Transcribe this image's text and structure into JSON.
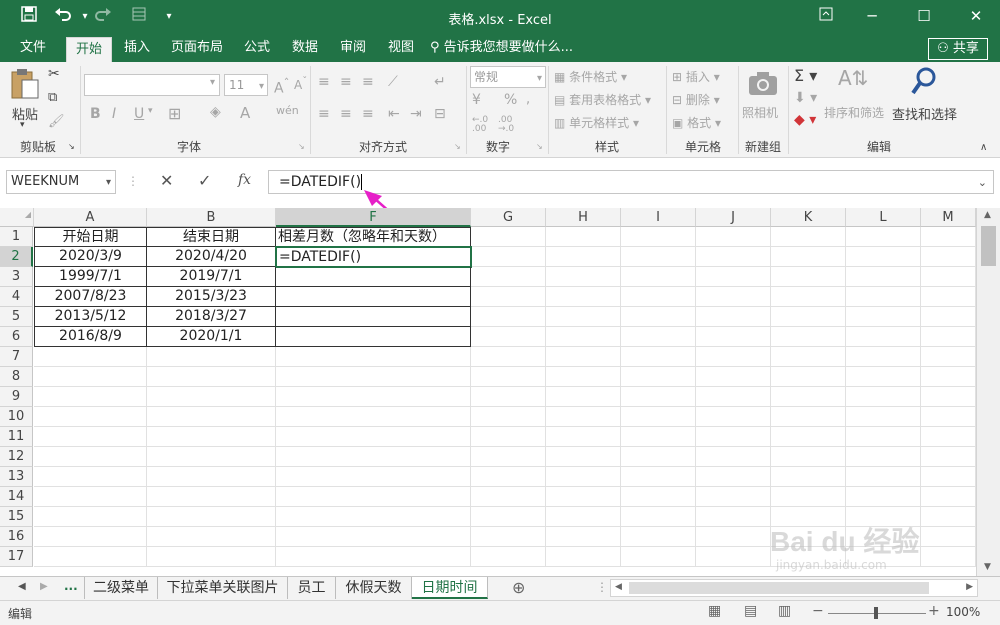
{
  "window": {
    "title": "表格.xlsx - Excel"
  },
  "tabs": [
    "文件",
    "开始",
    "插入",
    "页面布局",
    "公式",
    "数据",
    "审阅",
    "视图"
  ],
  "tellme": "告诉我您想要做什么...",
  "share": "共享",
  "ribbon": {
    "paste": "粘贴",
    "font_name": "",
    "font_size": "11",
    "number_format": "常规",
    "cond_format": "条件格式",
    "table_format": "套用表格格式",
    "cell_style": "单元格样式",
    "insert": "插入",
    "delete": "删除",
    "format": "格式",
    "camera": "照相机",
    "sort_filter": "排序和筛选",
    "find_select": "查找和选择",
    "groups": {
      "clipboard": "剪贴板",
      "font": "字体",
      "align": "对齐方式",
      "number": "数字",
      "styles": "样式",
      "cells": "单元格",
      "new_group": "新建组",
      "edit": "编辑"
    }
  },
  "namebox": "WEEKNUM",
  "formula": "=DATEDIF()",
  "columns": [
    "A",
    "B",
    "F",
    "G",
    "H",
    "I",
    "J",
    "K",
    "L",
    "M"
  ],
  "rows": [
    "1",
    "2",
    "3",
    "4",
    "5",
    "6",
    "7",
    "8",
    "9",
    "10",
    "11",
    "12",
    "13",
    "14",
    "15",
    "16",
    "17"
  ],
  "table": {
    "headers": [
      "开始日期",
      "结束日期",
      "相差月数（忽略年和天数）"
    ],
    "r2": [
      "2020/3/9",
      "2020/4/20",
      "=DATEDIF()"
    ],
    "r3": [
      "1999/7/1",
      "2019/7/1",
      ""
    ],
    "r4": [
      "2007/8/23",
      "2015/3/23",
      ""
    ],
    "r5": [
      "2013/5/12",
      "2018/3/27",
      ""
    ],
    "r6": [
      "2016/8/9",
      "2020/1/1",
      ""
    ]
  },
  "sheet_tabs": [
    "二级菜单",
    "下拉菜单关联图片",
    "员工",
    "休假天数",
    "日期时间"
  ],
  "sheet_more": "...",
  "status": {
    "mode": "编辑",
    "zoom": "100%"
  },
  "watermark": {
    "brand": "Bai du 经验",
    "url": "jingyan.baidu.com"
  },
  "accent": "#217346",
  "arrow_color": "#e620c8"
}
